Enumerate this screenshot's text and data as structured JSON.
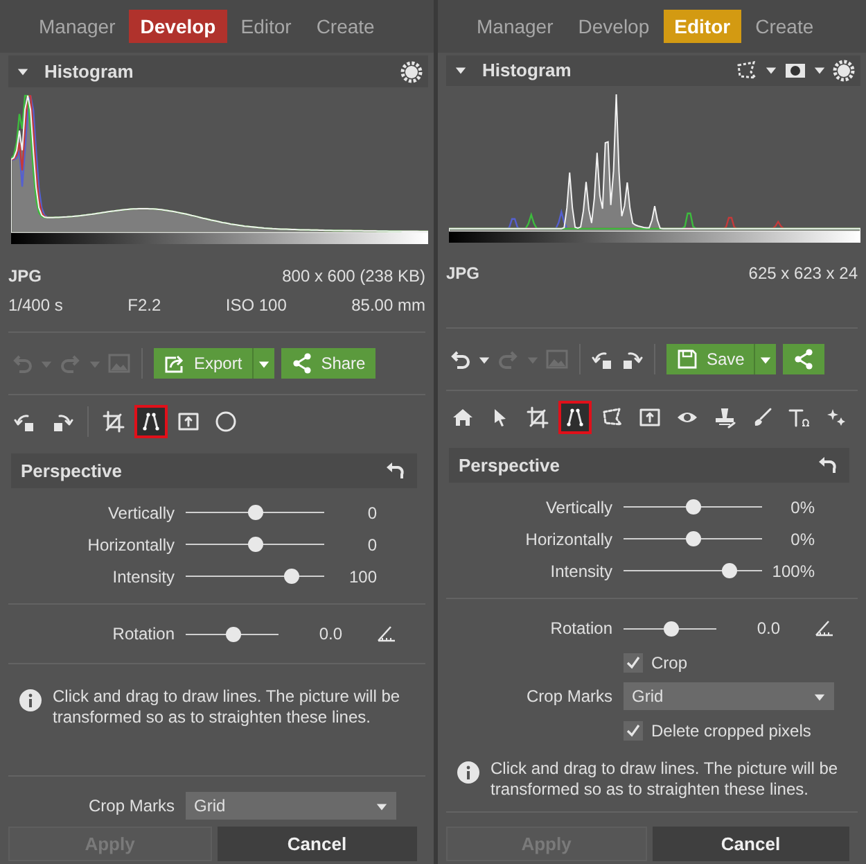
{
  "panels": [
    {
      "kind": "develop",
      "tabs": [
        {
          "label": "Manager",
          "selected": false
        },
        {
          "label": "Develop",
          "selected": true,
          "color": "#b0322c"
        },
        {
          "label": "Editor",
          "selected": false
        },
        {
          "label": "Create",
          "selected": false
        }
      ],
      "histogram": {
        "title": "Histogram",
        "kind": "broad"
      },
      "file_type": "JPG",
      "dimensions": "800 x 600 (238 KB)",
      "exif": [
        "1/400 s",
        "F2.2",
        "ISO 100",
        "85.00 mm"
      ],
      "undo_disabled": true,
      "redo_disabled": true,
      "primary_button": "Export",
      "share_label": "Share",
      "tools": [
        {
          "kind": "rotate-left",
          "selected": false
        },
        {
          "kind": "rotate-right",
          "selected": false
        },
        {
          "kind": "crop",
          "selected": false
        },
        {
          "kind": "perspective",
          "selected": true
        },
        {
          "kind": "level",
          "selected": false
        },
        {
          "kind": "circle",
          "selected": false
        }
      ],
      "section": {
        "title": "Perspective",
        "sliders": [
          {
            "label": "Vertically",
            "level": 0.5,
            "reading": "0"
          },
          {
            "label": "Horizontally",
            "level": 0.5,
            "reading": "0"
          },
          {
            "label": "Intensity",
            "level": 0.76,
            "reading": "100"
          }
        ],
        "rows": [
          {
            "kind": "divider"
          },
          {
            "kind": "rotation",
            "label": "Rotation",
            "level": 0.5,
            "reading": "0.0"
          },
          {
            "kind": "divider"
          },
          {
            "kind": "info",
            "text": "Click and drag to draw lines. The picture will be transformed so as to straighten these lines."
          },
          {
            "kind": "spacer"
          },
          {
            "kind": "divider"
          },
          {
            "kind": "select",
            "label": "Crop Marks",
            "value": "Grid"
          }
        ]
      },
      "buttons": [
        {
          "label": "Apply",
          "disabled": true
        },
        {
          "label": "Cancel",
          "disabled": false
        }
      ]
    },
    {
      "kind": "editor",
      "tabs": [
        {
          "label": "Manager",
          "selected": false
        },
        {
          "label": "Develop",
          "selected": false
        },
        {
          "label": "Editor",
          "selected": true,
          "color": "#d39a12"
        },
        {
          "label": "Create",
          "selected": false
        }
      ],
      "histogram": {
        "title": "Histogram",
        "kind": "spiky"
      },
      "file_type": "JPG",
      "dimensions": "625 x 623 x 24",
      "undo_disabled": false,
      "redo_disabled": true,
      "primary_button": "Save",
      "tools": [
        {
          "kind": "home",
          "selected": false
        },
        {
          "kind": "pointer",
          "selected": false
        },
        {
          "kind": "crop",
          "selected": false
        },
        {
          "kind": "perspective",
          "selected": true
        },
        {
          "kind": "selection",
          "selected": false
        },
        {
          "kind": "level",
          "selected": false
        },
        {
          "kind": "eye",
          "selected": false
        },
        {
          "kind": "clone",
          "selected": false
        },
        {
          "kind": "brush",
          "selected": false
        },
        {
          "kind": "text",
          "selected": false
        },
        {
          "kind": "effects",
          "selected": false
        }
      ],
      "section": {
        "title": "Perspective",
        "sliders": [
          {
            "label": "Vertically",
            "level": 0.5,
            "reading": "0%"
          },
          {
            "label": "Horizontally",
            "level": 0.5,
            "reading": "0%"
          },
          {
            "label": "Intensity",
            "level": 0.76,
            "reading": "100%"
          }
        ],
        "rows": [
          {
            "kind": "divider"
          },
          {
            "kind": "rotation",
            "label": "Rotation",
            "level": 0.5,
            "reading": "0.0"
          },
          {
            "kind": "checkbox",
            "label": "Crop",
            "checked": true
          },
          {
            "kind": "select",
            "label": "Crop Marks",
            "value": "Grid"
          },
          {
            "kind": "checkbox",
            "label": "Delete cropped pixels",
            "checked": true
          },
          {
            "kind": "info",
            "text": "Click and drag to draw lines. The picture will be transformed so as to straighten these lines."
          },
          {
            "kind": "spacer"
          },
          {
            "kind": "divider"
          }
        ]
      },
      "buttons": [
        {
          "label": "Apply",
          "disabled": true
        },
        {
          "label": "Cancel",
          "disabled": false
        }
      ]
    }
  ]
}
